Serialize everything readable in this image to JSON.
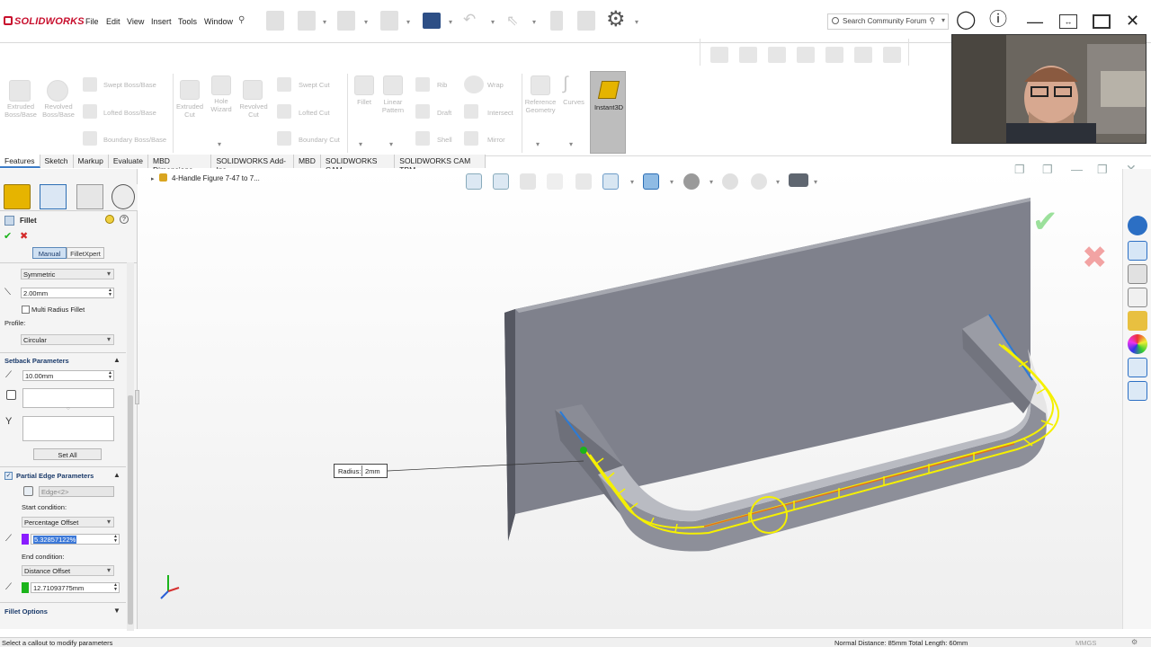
{
  "app": {
    "name": "SOLIDWORKS"
  },
  "menu": [
    "File",
    "Edit",
    "View",
    "Insert",
    "Tools",
    "Window"
  ],
  "search": {
    "placeholder": "Search Community Forum"
  },
  "commands": {
    "large": [
      {
        "label": "Extruded\nBoss/Base"
      },
      {
        "label": "Revolved\nBoss/Base"
      },
      {
        "label": "Extruded\nCut"
      },
      {
        "label": "Hole\nWizard"
      },
      {
        "label": "Revolved\nCut"
      },
      {
        "label": "Fillet"
      },
      {
        "label": "Linear\nPattern"
      },
      {
        "label": "Reference\nGeometry"
      },
      {
        "label": "Curves"
      }
    ],
    "small": {
      "swept_boss": "Swept Boss/Base",
      "lofted_boss": "Lofted Boss/Base",
      "boundary_boss": "Boundary Boss/Base",
      "swept_cut": "Swept Cut",
      "lofted_cut": "Lofted Cut",
      "boundary_cut": "Boundary Cut",
      "rib": "Rib",
      "draft": "Draft",
      "shell": "Shell",
      "wrap": "Wrap",
      "intersect": "Intersect",
      "mirror": "Mirror"
    },
    "instant3d": "Instant3D"
  },
  "tabs": [
    "Features",
    "Sketch",
    "Markup",
    "Evaluate",
    "MBD Dimensions",
    "SOLIDWORKS Add-Ins",
    "MBD",
    "SOLIDWORKS CAM",
    "SOLIDWORKS CAM TBM"
  ],
  "feature_path": "4-Handle Figure 7-47 to 7...",
  "property_manager": {
    "title": "Fillet",
    "mode_manual": "Manual",
    "mode_filletxpert": "FilletXpert",
    "fillet_method": "Symmetric",
    "radius": "2.00mm",
    "multi_radius": "Multi Radius Fillet",
    "profile_label": "Profile:",
    "profile": "Circular",
    "setback_header": "Setback Parameters",
    "setback_distance": "10.00mm",
    "set_all": "Set All",
    "partial_header": "Partial Edge Parameters",
    "edge": "Edge<2>",
    "start_condition_label": "Start condition:",
    "start_condition": "Percentage Offset",
    "start_value": "5.32857122%",
    "end_condition_label": "End condition:",
    "end_condition": "Distance Offset",
    "end_value": "12.71093775mm",
    "fillet_options": "Fillet Options",
    "start_color": "#8a1cff",
    "end_color": "#1bb41b"
  },
  "callout": {
    "label": "Radius:",
    "value": "2mm"
  },
  "status": {
    "left": "Select a callout to modify parameters",
    "right": "Normal Distance: 85mm Total Length: 60mm",
    "units": "MMGS"
  },
  "colors": {
    "selection": "#f5f000",
    "accent": "#3c7cc7",
    "model": "#7d7f8a"
  }
}
